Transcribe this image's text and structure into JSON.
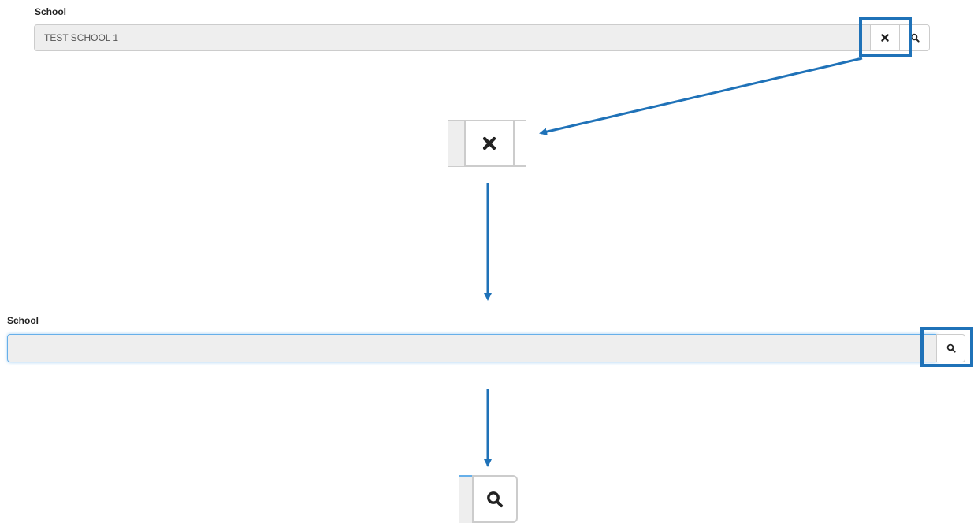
{
  "step1": {
    "label": "School",
    "input_value": "TEST SCHOOL 1",
    "clear_icon": "close-icon",
    "search_icon": "search-icon"
  },
  "zoom1": {
    "clear_icon": "close-icon"
  },
  "step2": {
    "label": "School",
    "input_value": "",
    "search_icon": "search-icon"
  },
  "zoom2": {
    "search_icon": "search-icon"
  },
  "colors": {
    "highlight": "#1f72b8",
    "arrow": "#1f72b8",
    "input_bg": "#eeeeee",
    "focus_border": "#66afe9"
  }
}
